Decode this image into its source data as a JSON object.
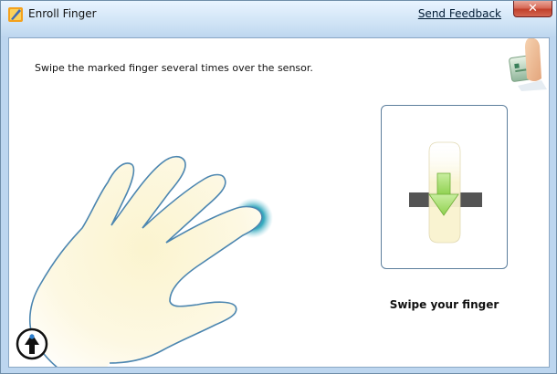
{
  "window": {
    "title": "Enroll Finger",
    "send_feedback": "Send Feedback",
    "close_glyph": "✕"
  },
  "main": {
    "instruction": "Swipe the marked finger several times over the sensor.",
    "sensor_caption": "Swipe your finger",
    "marked_finger": "little finger"
  },
  "icons": {
    "app": "app-logo-icon",
    "help": "help-arrow-icon",
    "corner": "fingerprint-reader-illustration",
    "hand": "left-hand-outline",
    "swipe": "swipe-down-arrow"
  },
  "colors": {
    "accent": "#2b9fb4",
    "arrow": "#8fd14f",
    "hand_outline": "#4c86b0",
    "hand_fill": "#fdf6d0"
  }
}
